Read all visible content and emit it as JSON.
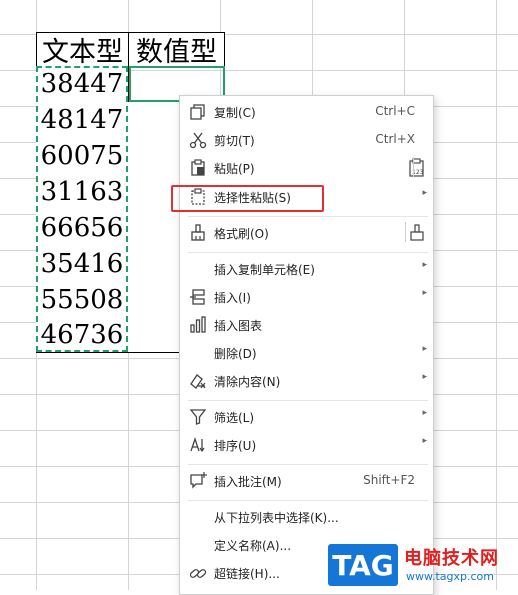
{
  "sheet": {
    "headers": [
      "文本型",
      "数值型"
    ],
    "values": [
      "38447",
      "48147",
      "60075",
      "31163",
      "66656",
      "35416",
      "55508",
      "46736"
    ]
  },
  "context_menu": {
    "copy": {
      "label": "复制(C)",
      "shortcut": "Ctrl+C",
      "icon": "copy-icon"
    },
    "cut": {
      "label": "剪切(T)",
      "shortcut": "Ctrl+X",
      "icon": "scissors-icon"
    },
    "paste": {
      "label": "粘贴(P)",
      "icon": "clipboard-icon",
      "paste_values_icon": "paste-values-icon"
    },
    "paste_special": {
      "label": "选择性粘贴(S)",
      "icon": "paste-special-icon"
    },
    "format_painter": {
      "label": "格式刷(O)",
      "icon": "format-brush-icon"
    },
    "insert_copied": {
      "label": "插入复制单元格(E)"
    },
    "insert": {
      "label": "插入(I)",
      "icon": "insert-icon"
    },
    "insert_chart": {
      "label": "插入图表",
      "icon": "bar-chart-icon"
    },
    "delete": {
      "label": "删除(D)"
    },
    "clear": {
      "label": "清除内容(N)",
      "icon": "eraser-icon"
    },
    "filter": {
      "label": "筛选(L)",
      "icon": "filter-icon"
    },
    "sort": {
      "label": "排序(U)",
      "icon": "sort-icon"
    },
    "insert_comment": {
      "label": "插入批注(M)",
      "shortcut": "Shift+F2",
      "icon": "comment-icon"
    },
    "pick_from_list": {
      "label": "从下拉列表中选择(K)..."
    },
    "define_name": {
      "label": "定义名称(A)..."
    },
    "hyperlink": {
      "label": "超链接(H)...",
      "icon": "link-icon"
    },
    "submenu_arrow": "▸"
  },
  "watermark": {
    "tag": "TAG",
    "title": "电脑技术网",
    "url": "www.tagxp.com"
  },
  "colors": {
    "selection_green": "#22a06b",
    "highlight_red": "#e03030",
    "watermark_blue": "#1477d8",
    "watermark_red": "#e02020"
  }
}
